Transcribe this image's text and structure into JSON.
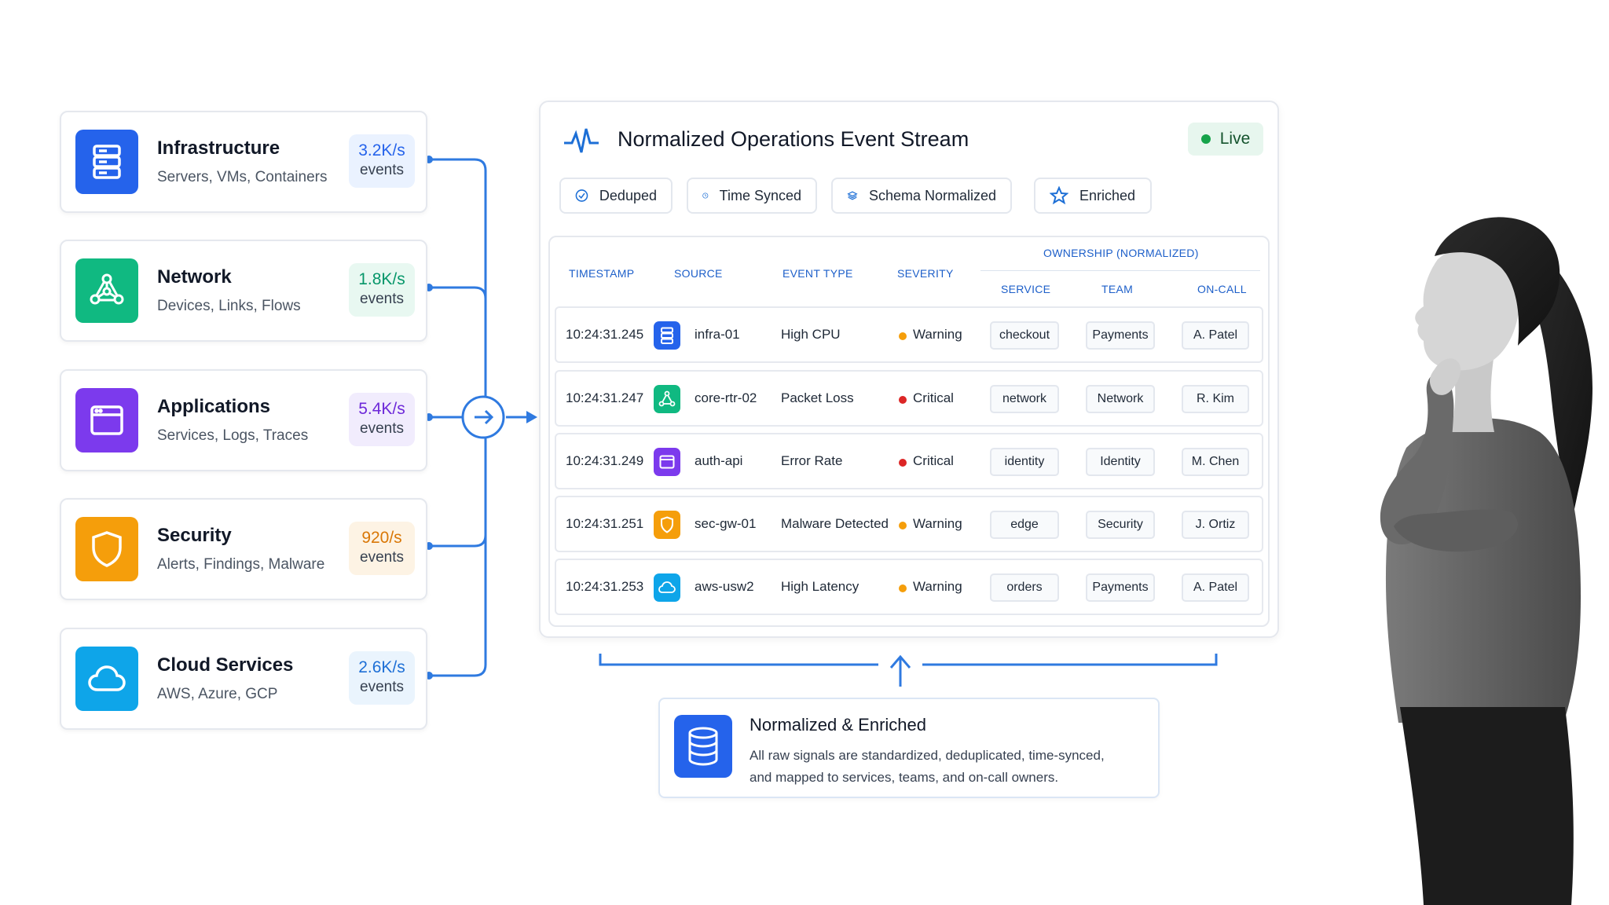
{
  "sources": [
    {
      "title": "Infrastructure",
      "subtitle": "Servers, VMs, Containers",
      "rate": "3.2K/s",
      "unit": "events",
      "icon": "server-icon",
      "color": "#2563eb",
      "rate_color": "#2563eb",
      "rate_bg": "#eaf2ff"
    },
    {
      "title": "Network",
      "subtitle": "Devices, Links, Flows",
      "rate": "1.8K/s",
      "unit": "events",
      "icon": "network-icon",
      "color": "#10b981",
      "rate_color": "#059669",
      "rate_bg": "#e8f8f1"
    },
    {
      "title": "Applications",
      "subtitle": "Services, Logs, Traces",
      "rate": "5.4K/s",
      "unit": "events",
      "icon": "app-window-icon",
      "color": "#7c3aed",
      "rate_color": "#6d28d9",
      "rate_bg": "#f1ecfd"
    },
    {
      "title": "Security",
      "subtitle": "Alerts, Findings, Malware",
      "rate": "920/s",
      "unit": "events",
      "icon": "shield-icon",
      "color": "#f59e0b",
      "rate_color": "#d97706",
      "rate_bg": "#fdf3e4"
    },
    {
      "title": "Cloud Services",
      "subtitle": "AWS, Azure, GCP",
      "rate": "2.6K/s",
      "unit": "events",
      "icon": "cloud-icon",
      "color": "#0ea5e9",
      "rate_color": "#1d6fd6",
      "rate_bg": "#eaf4fd"
    }
  ],
  "panel": {
    "title": "Normalized Operations Event Stream",
    "status": "Live",
    "chips": [
      "Deduped",
      "Time Synced",
      "Schema Normalized",
      "Enriched"
    ],
    "columns": {
      "timestamp": "TIMESTAMP",
      "source": "SOURCE",
      "event_type": "EVENT TYPE",
      "severity": "SEVERITY",
      "ownership": "OWNERSHIP (NORMALIZED)",
      "service": "SERVICE",
      "team": "TEAM",
      "oncall": "ON-CALL"
    },
    "rows": [
      {
        "timestamp": "10:24:31.245",
        "source": "infra-01",
        "source_icon": "server-icon",
        "event_type": "High CPU",
        "severity": "Warning",
        "service": "checkout",
        "team": "Payments",
        "oncall": "A. Patel"
      },
      {
        "timestamp": "10:24:31.247",
        "source": "core-rtr-02",
        "source_icon": "network-icon",
        "event_type": "Packet Loss",
        "severity": "Critical",
        "service": "network",
        "team": "Network",
        "oncall": "R. Kim"
      },
      {
        "timestamp": "10:24:31.249",
        "source": "auth-api",
        "source_icon": "app-window-icon",
        "event_type": "Error Rate",
        "severity": "Critical",
        "service": "identity",
        "team": "Identity",
        "oncall": "M. Chen"
      },
      {
        "timestamp": "10:24:31.251",
        "source": "sec-gw-01",
        "source_icon": "shield-icon",
        "event_type": "Malware Detected",
        "severity": "Warning",
        "service": "edge",
        "team": "Security",
        "oncall": "J. Ortiz"
      },
      {
        "timestamp": "10:24:31.253",
        "source": "aws-usw2",
        "source_icon": "cloud-icon",
        "event_type": "High Latency",
        "severity": "Warning",
        "service": "orders",
        "team": "Payments",
        "oncall": "A. Patel"
      }
    ],
    "severity_colors": {
      "Warning": "#f59e0b",
      "Critical": "#dc2626"
    }
  },
  "result": {
    "title": "Normalized & Enriched",
    "text": "All raw signals are standardized, deduplicated, time-synced, and mapped to services, teams, and on-call owners."
  },
  "colors": {
    "accent": "#1d6fd6",
    "connector": "#2f7ae0"
  }
}
